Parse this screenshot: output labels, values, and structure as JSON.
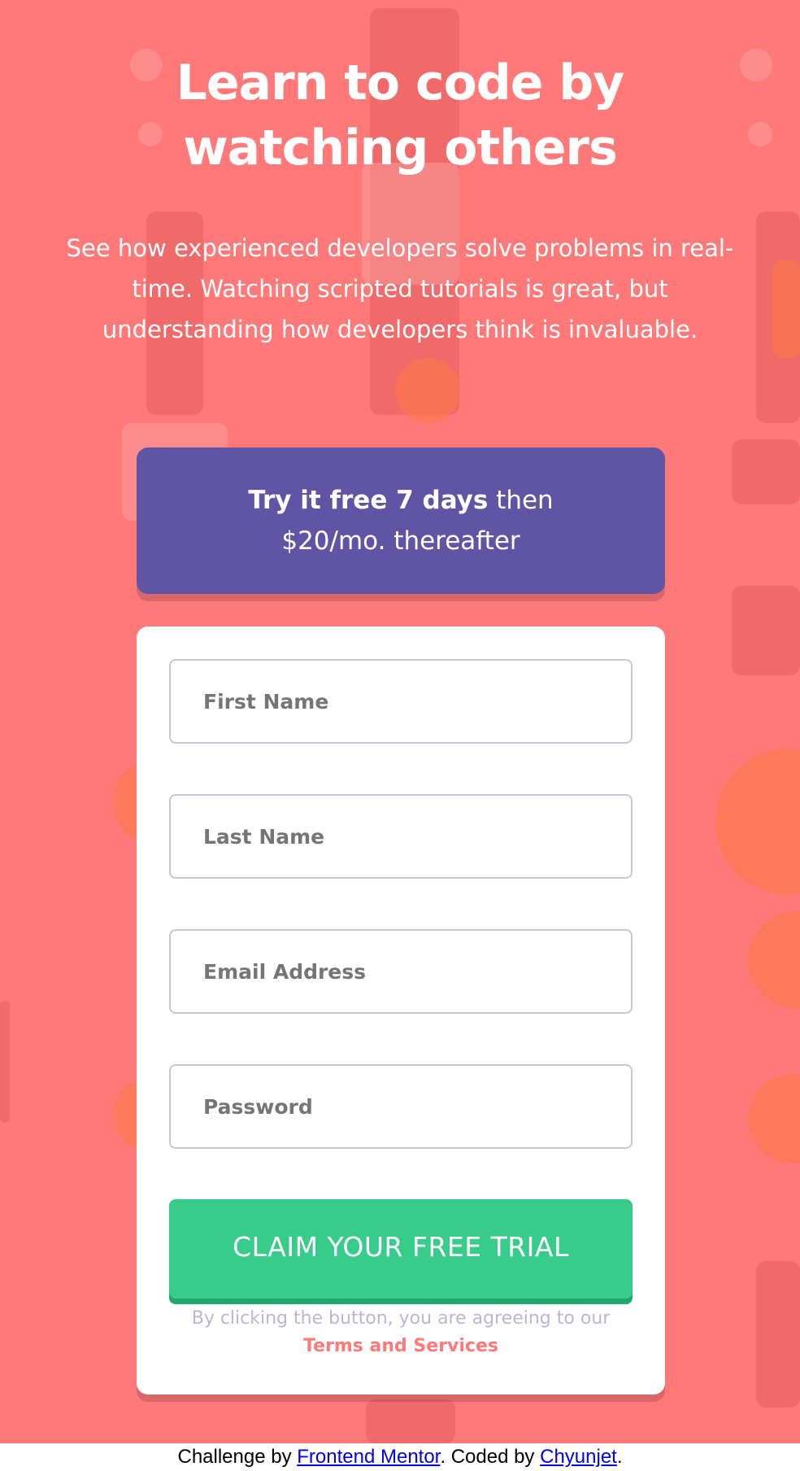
{
  "hero": {
    "title_line1": "Learn to code by",
    "title_line2": "watching others",
    "subtitle": "See how experienced developers solve problems in real-time. Watching scripted tutorials is great, but understanding how developers think is invaluable."
  },
  "promo": {
    "strong_text": "Try it free 7 days",
    "rest_text": " then",
    "line2": "$20/mo. thereafter"
  },
  "form": {
    "first_name_placeholder": "First Name",
    "last_name_placeholder": "Last Name",
    "email_placeholder": "Email Address",
    "password_placeholder": "Password",
    "submit_label": "CLAIM YOUR FREE TRIAL",
    "legal_text": "By clicking the button, you are agreeing to our",
    "terms_link": "Terms and Services"
  },
  "footer": {
    "prefix": "Challenge by ",
    "frontend_mentor_link": "Frontend Mentor",
    "middle": ". Coded by ",
    "author_link": "Chyunjet",
    "suffix": "."
  },
  "colors": {
    "background": "#ff7979",
    "promo": "#6055a5",
    "cta": "#38cc8b",
    "terms_link": "#ff7979",
    "legal_text": "#b9b6d3"
  }
}
